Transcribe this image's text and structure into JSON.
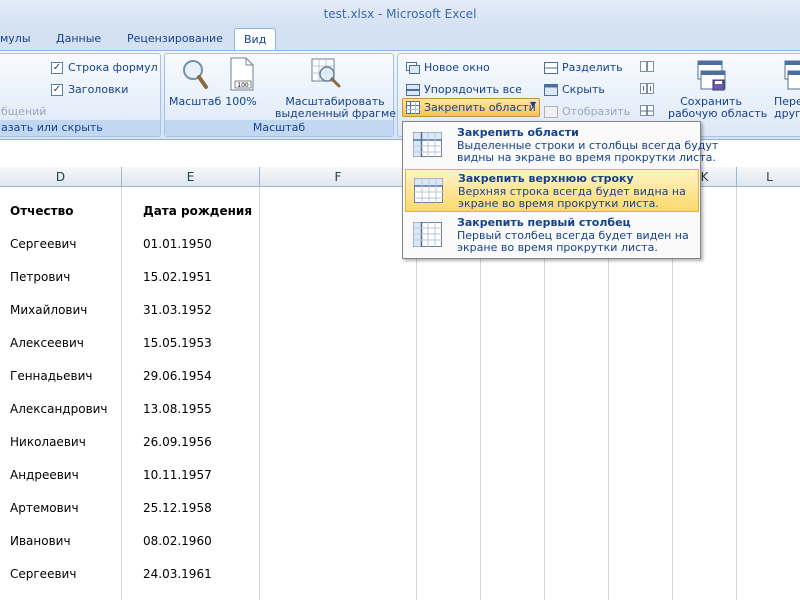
{
  "window": {
    "title": "test.xlsx - Microsoft Excel"
  },
  "tabs": [
    "мулы",
    "Данные",
    "Рецензирование",
    "Вид"
  ],
  "ribbon": {
    "show_group": {
      "cb_formula_bar": "Строка формул",
      "cb_headings": "Заголовки",
      "partial_text": "бщений",
      "label": "азать или скрыть"
    },
    "zoom_group": {
      "zoom": "Масштаб",
      "zoom100": "100%",
      "zoom_sel_line1": "Масштабировать",
      "zoom_sel_line2": "выделенный фрагмент",
      "label": "Масштаб"
    },
    "window_group": {
      "new_window": "Новое окно",
      "arrange_all": "Упорядочить все",
      "freeze_panes": "Закрепить области",
      "split": "Разделить",
      "hide": "Скрыть",
      "unhide": "Отобразить",
      "save_workspace_line1": "Сохранить",
      "save_workspace_line2": "рабочую область",
      "switch_line1": "Пере",
      "switch_line2": "другое"
    }
  },
  "freeze_menu": [
    {
      "title": "Закрепить области",
      "desc1": "Выделенные строки и столбцы всегда будут",
      "desc2": "видны на экране во время прокрутки листа."
    },
    {
      "title": "Закрепить верхнюю строку",
      "desc1": "Верхняя строка всегда будет видна на",
      "desc2": "экране во время прокрутки листа."
    },
    {
      "title": "Закрепить первый столбец",
      "desc1": "Первый столбец всегда будет виден на",
      "desc2": "экране во время прокрутки листа."
    }
  ],
  "columns": [
    "D",
    "E",
    "F",
    "K",
    "L"
  ],
  "sheet": {
    "headers": {
      "patronymic": "Отчество",
      "birth_date": "Дата рождения"
    },
    "rows": [
      {
        "patronymic": "Сергеевич",
        "birth_date": "01.01.1950"
      },
      {
        "patronymic": "Петрович",
        "birth_date": "15.02.1951"
      },
      {
        "patronymic": "Михайлович",
        "birth_date": "31.03.1952"
      },
      {
        "patronymic": "Алексеевич",
        "birth_date": "15.05.1953"
      },
      {
        "patronymic": "Геннадьевич",
        "birth_date": "29.06.1954"
      },
      {
        "patronymic": "Александрович",
        "birth_date": "13.08.1955"
      },
      {
        "patronymic": "Николаевич",
        "birth_date": "26.09.1956"
      },
      {
        "patronymic": "Андреевич",
        "birth_date": "10.11.1957"
      },
      {
        "patronymic": "Артемович",
        "birth_date": "25.12.1958"
      },
      {
        "patronymic": "Иванович",
        "birth_date": "08.02.1960"
      },
      {
        "patronymic": "Сергеевич",
        "birth_date": "24.03.1961"
      }
    ]
  }
}
